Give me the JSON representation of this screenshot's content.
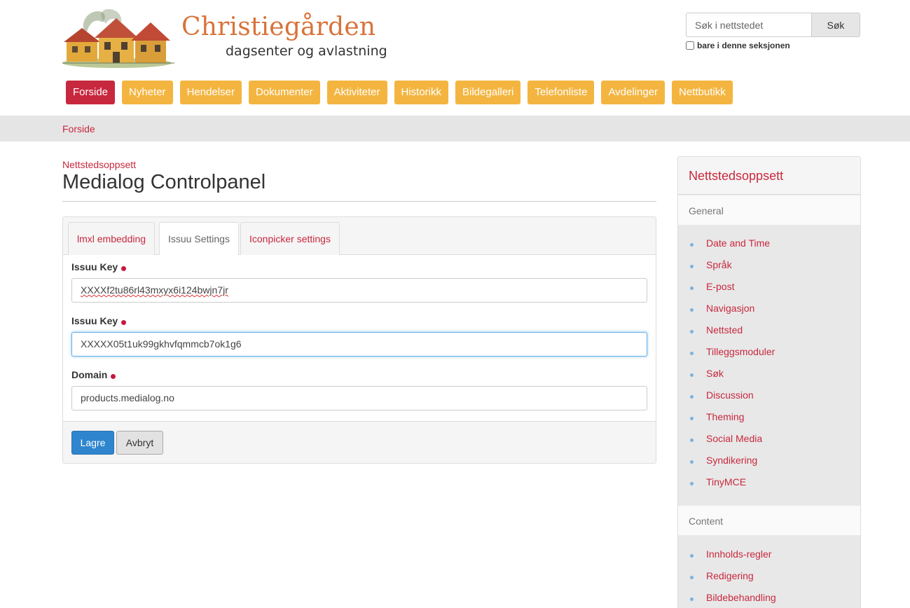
{
  "brand": {
    "title": "Christiegården",
    "subtitle": "dagsenter og avlastning"
  },
  "search": {
    "placeholder": "Søk i nettstedet",
    "button_label": "Søk",
    "scope_label": "bare i denne seksjonen"
  },
  "nav": {
    "items": [
      {
        "label": "Forside"
      },
      {
        "label": "Nyheter"
      },
      {
        "label": "Hendelser"
      },
      {
        "label": "Dokumenter"
      },
      {
        "label": "Aktiviteter"
      },
      {
        "label": "Historikk"
      },
      {
        "label": "Bildegalleri"
      },
      {
        "label": "Telefonliste"
      },
      {
        "label": "Avdelinger"
      },
      {
        "label": "Nettbutikk"
      }
    ],
    "active_color": "#c8283e",
    "item_color": "#f4b540"
  },
  "breadcrumb": {
    "home": "Forside"
  },
  "main": {
    "section_link": "Nettstedsoppsett",
    "title": "Medialog Controlpanel",
    "tabs": [
      {
        "label": "lmxl embedding"
      },
      {
        "label": "Issuu Settings"
      },
      {
        "label": "Iconpicker settings"
      }
    ],
    "active_tab": "Issuu Settings",
    "fields": [
      {
        "label": "Issuu Key",
        "value": "XXXXf2tu86rl43mxyx6i124bwjn7jr"
      },
      {
        "label": "Issuu Key",
        "value": "XXXXX05t1uk99gkhvfqmmcb7ok1g6"
      },
      {
        "label": "Domain",
        "value": "products.medialog.no"
      }
    ],
    "save_label": "Lagre",
    "cancel_label": "Avbryt"
  },
  "sidebar": {
    "title": "Nettstedsoppsett",
    "groups": [
      {
        "label": "General",
        "items": [
          {
            "label": "Date and Time"
          },
          {
            "label": "Språk"
          },
          {
            "label": "E-post"
          },
          {
            "label": "Navigasjon"
          },
          {
            "label": "Nettsted"
          },
          {
            "label": "Tilleggsmoduler"
          },
          {
            "label": "Søk"
          },
          {
            "label": "Discussion"
          },
          {
            "label": "Theming"
          },
          {
            "label": "Social Media"
          },
          {
            "label": "Syndikering"
          },
          {
            "label": "TinyMCE"
          }
        ]
      },
      {
        "label": "Content",
        "items": [
          {
            "label": "Innholds-regler"
          },
          {
            "label": "Redigering"
          },
          {
            "label": "Bildebehandling"
          }
        ]
      }
    ]
  }
}
